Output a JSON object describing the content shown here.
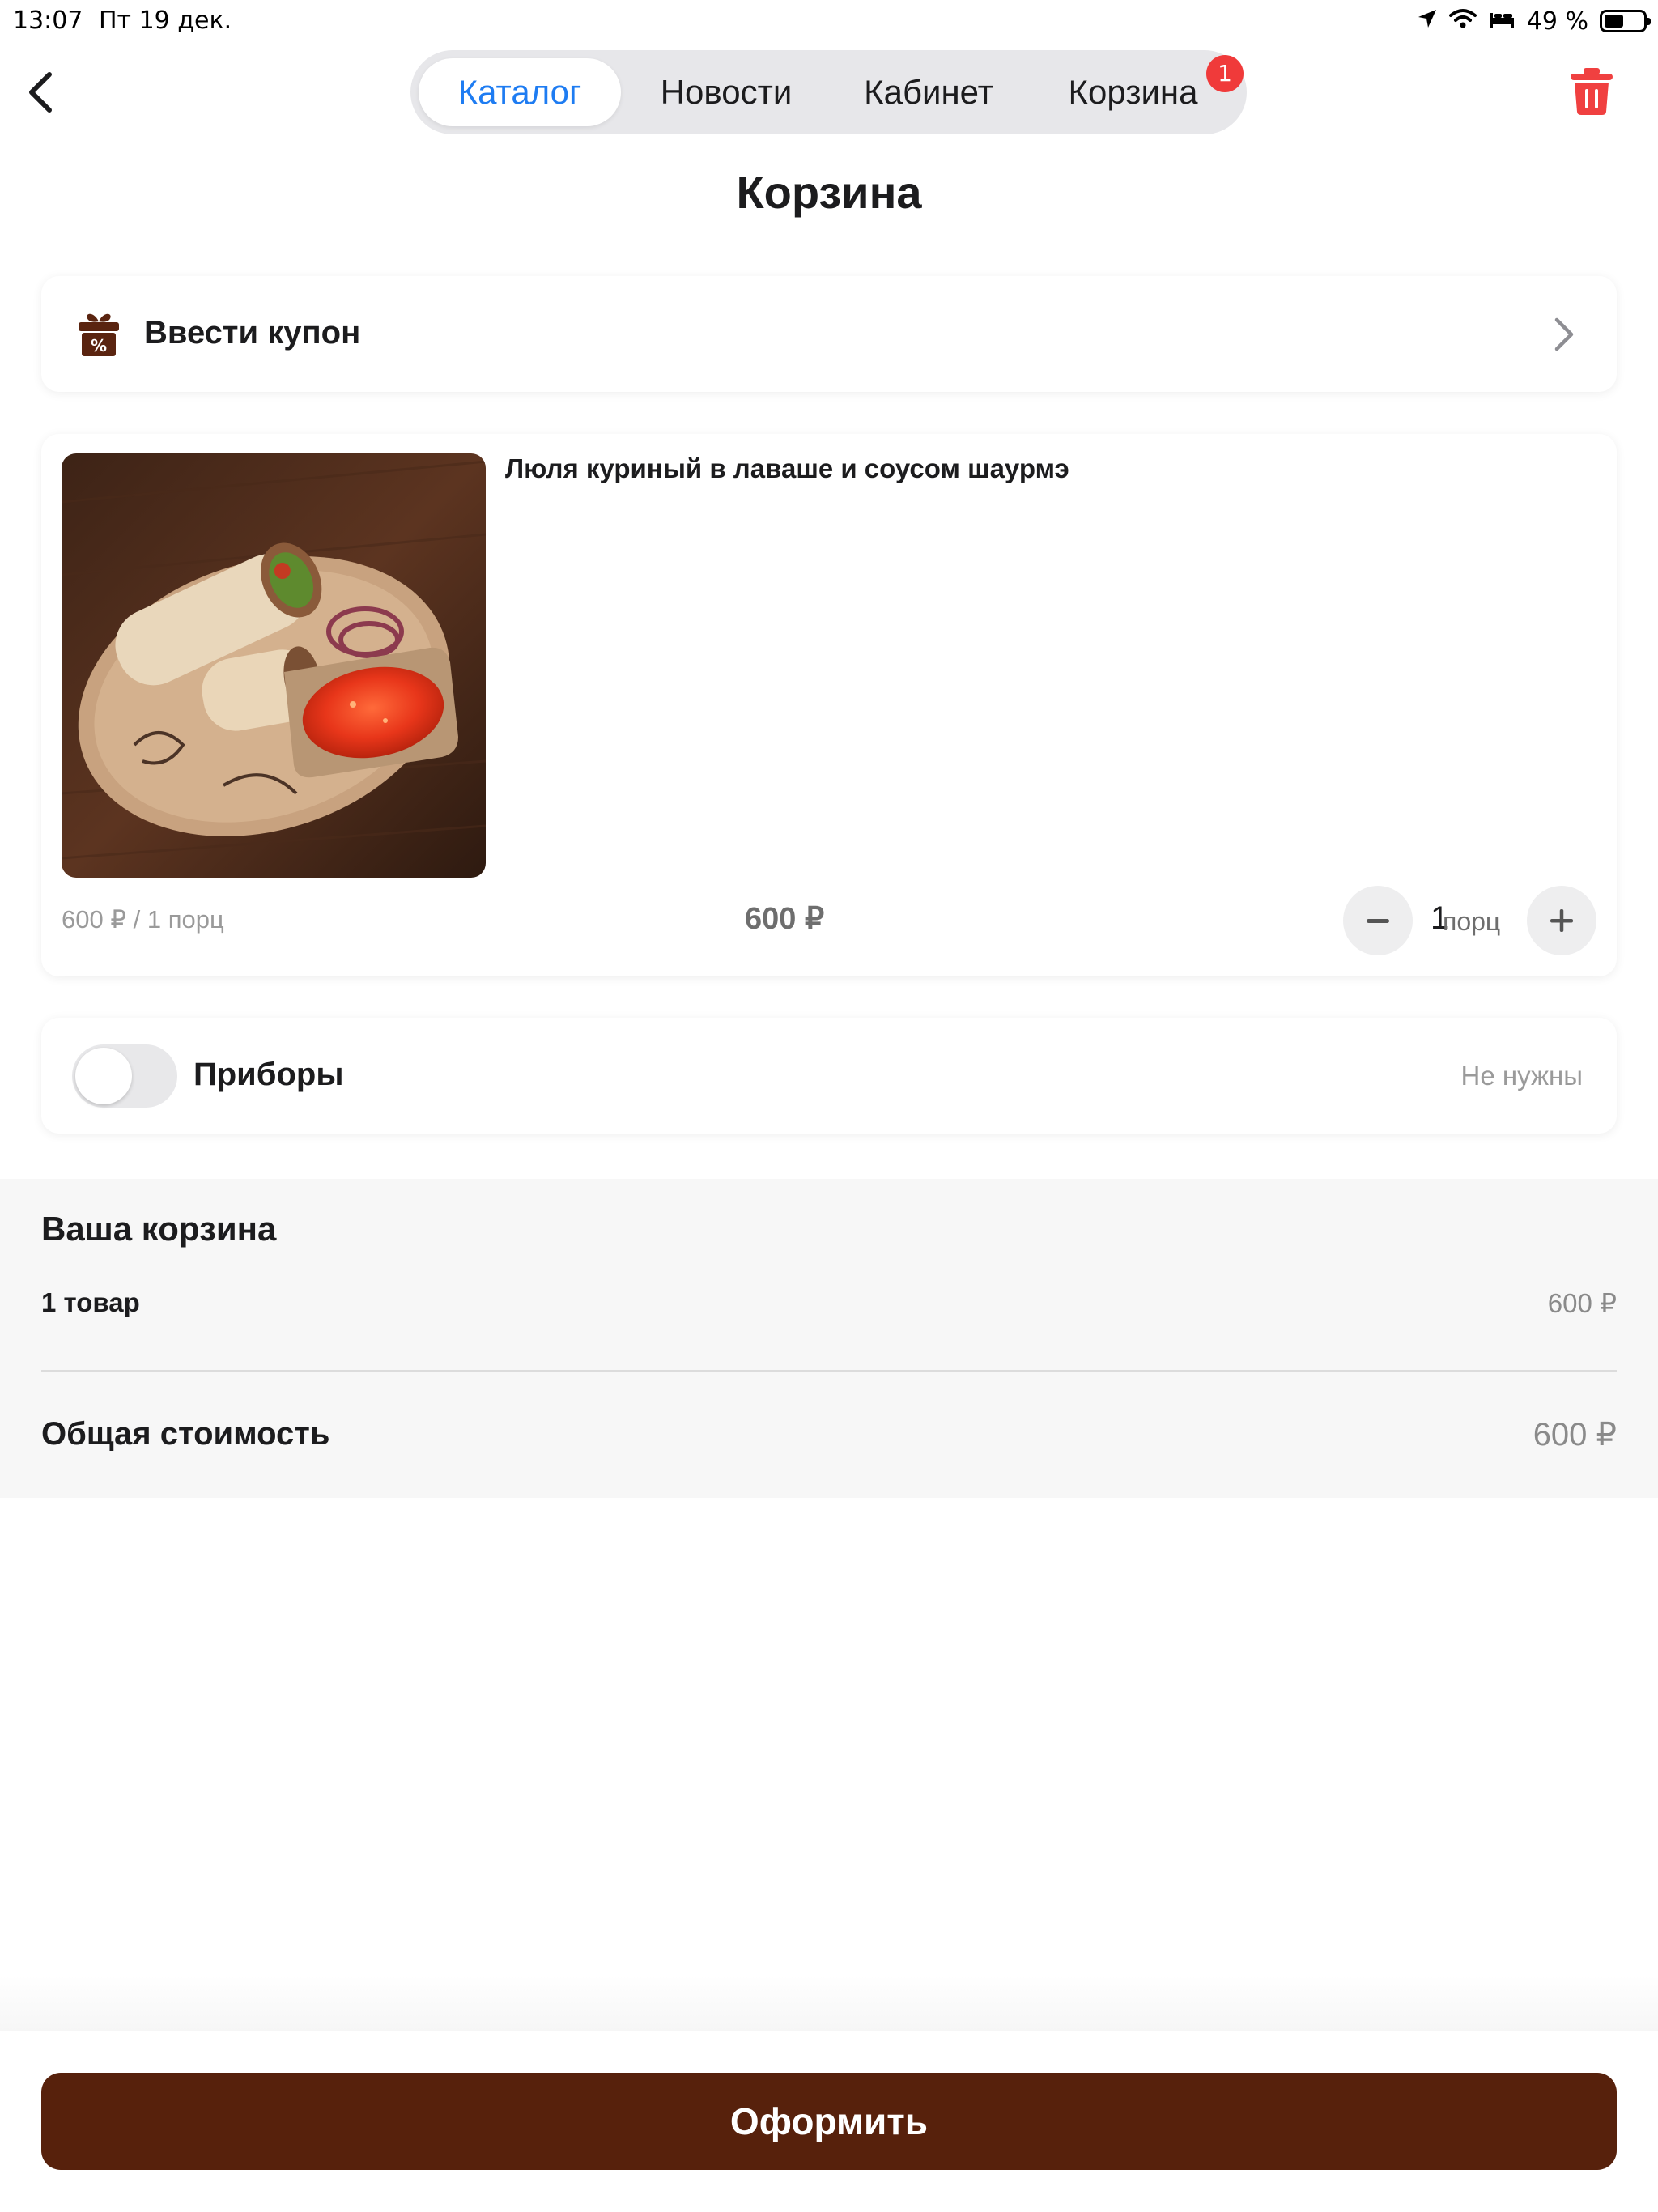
{
  "status_bar": {
    "time": "13:07",
    "date": "Пт 19 дек.",
    "battery": "49 %",
    "battery_level": 0.49,
    "icons": [
      "location-arrow-icon",
      "wifi-icon",
      "sleep-bed-icon",
      "battery-icon"
    ]
  },
  "nav": {
    "back_icon": "chevron-left-icon",
    "tabs": [
      {
        "label": "Каталог",
        "active": true
      },
      {
        "label": "Новости",
        "active": false
      },
      {
        "label": "Кабинет",
        "active": false
      },
      {
        "label": "Корзина",
        "active": false
      }
    ],
    "cart_badge": "1",
    "trash_icon": "trash-icon"
  },
  "page": {
    "title": "Корзина"
  },
  "coupon": {
    "label": "Ввести купон",
    "icon": "gift-percent-icon"
  },
  "cart_item": {
    "name": "Люля куриный в лаваше и соусом шаурмэ",
    "unit_price": "600 ₽ / 1 порц",
    "total": "600 ₽",
    "quantity": "1",
    "quantity_unit": "порц",
    "image": "shawarma-plate-photo"
  },
  "cutlery": {
    "label": "Приборы",
    "status": "Не нужны",
    "enabled": false
  },
  "summary": {
    "title": "Ваша корзина",
    "items_label": "1 товар",
    "items_price": "600 ₽",
    "total_label": "Общая стоимость",
    "total_price": "600 ₽"
  },
  "checkout": {
    "label": "Оформить"
  },
  "colors": {
    "accent": "#1e7cf2",
    "badge": "#f03a3a",
    "trash": "#f04040",
    "checkout": "#57210c",
    "coupon_icon": "#5a2410"
  }
}
